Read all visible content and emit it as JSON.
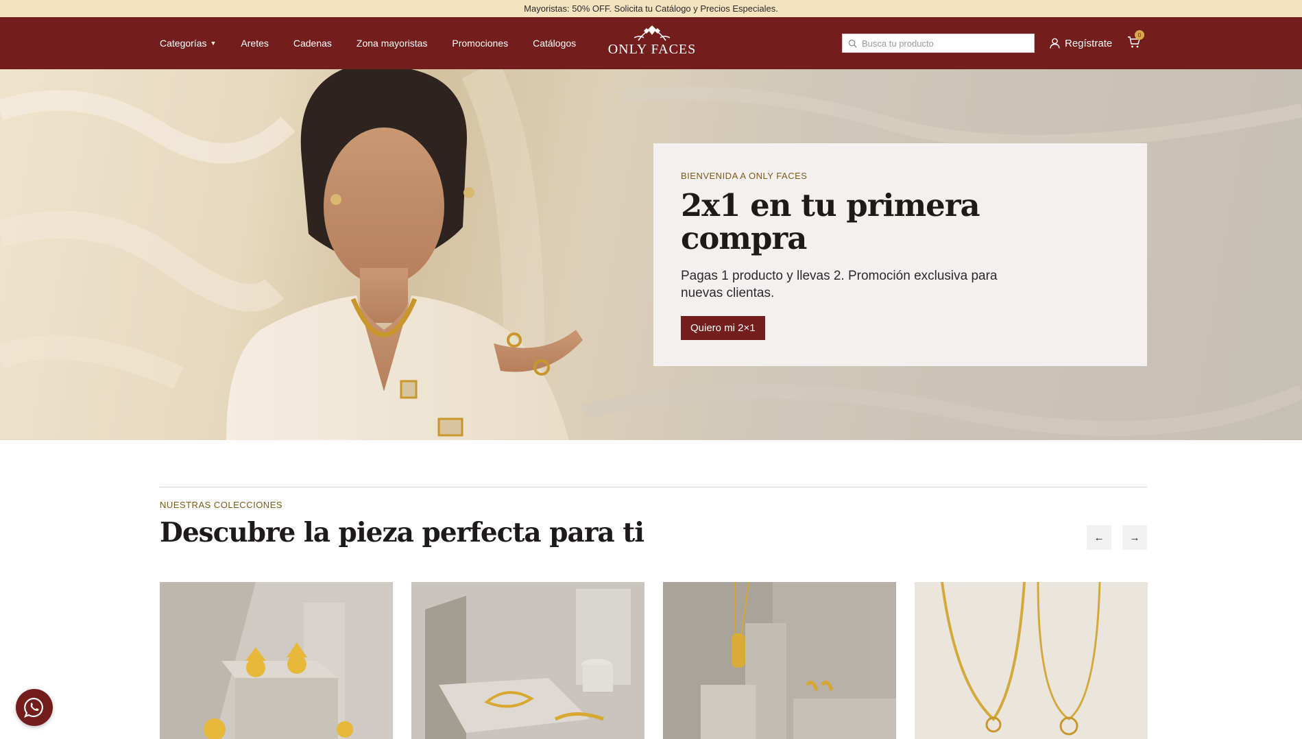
{
  "announcement": "Mayoristas: 50% OFF. Solicita tu Catálogo y Precios Especiales.",
  "nav": {
    "links": [
      "Categorías",
      "Aretes",
      "Cadenas",
      "Zona mayoristas",
      "Promociones",
      "Catálogos"
    ],
    "logo_text": "ONLY FACES",
    "search_placeholder": "Busca tu producto",
    "register_label": "Regístrate",
    "cart_count": "0"
  },
  "hero": {
    "eyebrow": "BIENVENIDA A ONLY FACES",
    "title": "2x1 en tu primera compra",
    "text": "Pagas 1 producto y llevas 2. Promoción exclusiva para nuevas clientas.",
    "button_label": "Quiero mi 2×1"
  },
  "collections": {
    "eyebrow": "NUESTRAS COLECCIONES",
    "title": "Descubre la pieza perfecta para ti"
  },
  "colors": {
    "brand": "#731d1d",
    "announcement_bg": "#f3e3bf",
    "accent_gold": "#7a5a12"
  },
  "icons": [
    "search-icon",
    "user-icon",
    "cart-icon",
    "arrow-left-icon",
    "arrow-right-icon",
    "whatsapp-icon"
  ]
}
